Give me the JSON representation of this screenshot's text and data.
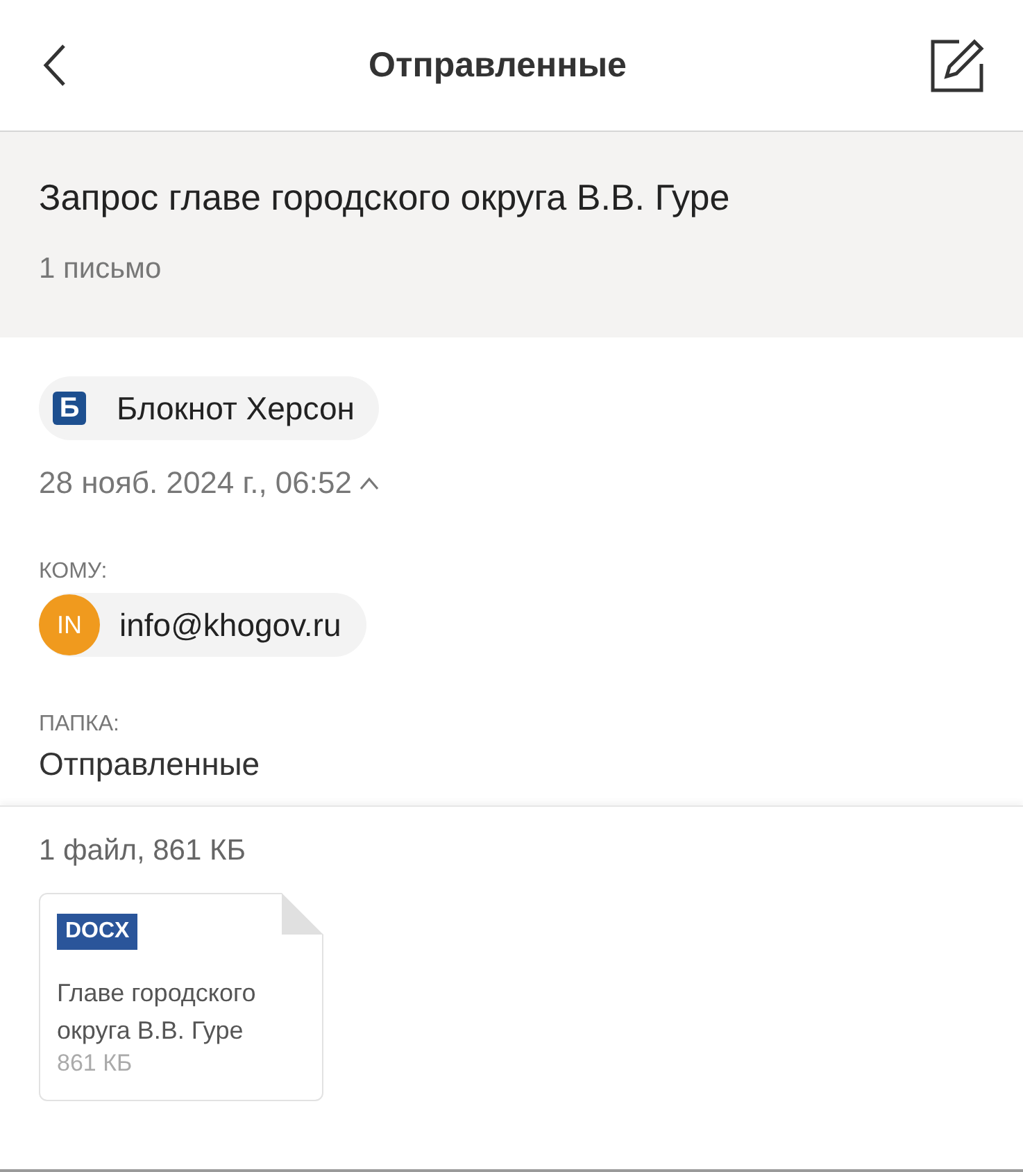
{
  "header": {
    "title": "Отправленные"
  },
  "thread": {
    "subject": "Запрос главе городского округа В.В. Гуре",
    "count": "1 письмо"
  },
  "message": {
    "sender": {
      "logo": "Б",
      "name": "Блокнот Херсон"
    },
    "date": "28 нояб. 2024 г., 06:52",
    "details_expanded": true,
    "to_label": "КОМУ:",
    "recipients": [
      {
        "initials": "IN",
        "address": "info@khogov.ru",
        "color": "#f09a1e"
      }
    ],
    "folder_label": "ПАПКА:",
    "folder": "Отправленные"
  },
  "attachments": {
    "summary": "1 файл, 861 КБ",
    "files": [
      {
        "type": "DOCX",
        "name": "Главе городского округа В.В. Гуре",
        "size": "861 КБ"
      }
    ]
  }
}
